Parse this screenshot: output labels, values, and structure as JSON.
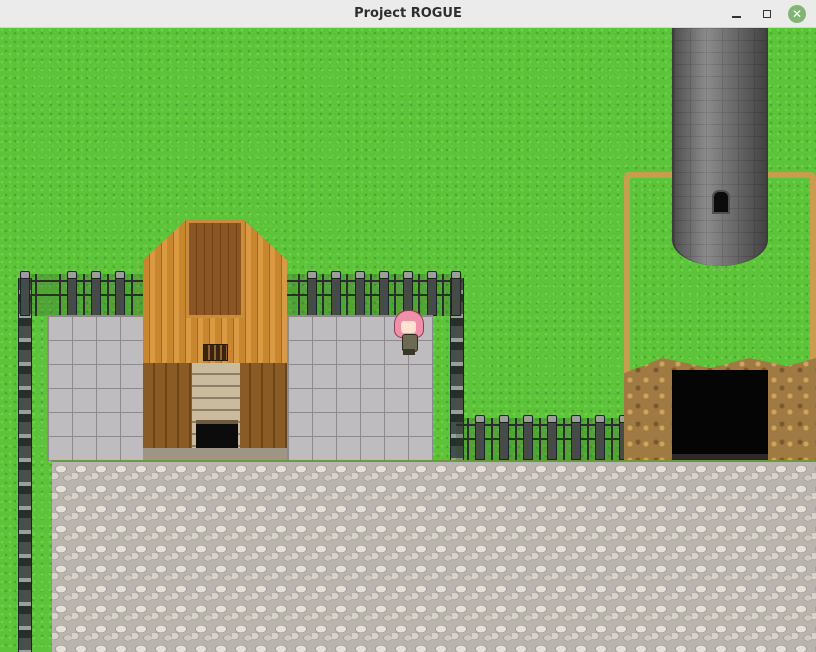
{
  "window": {
    "title": "Project ROGUE",
    "controls": {
      "minimize_icon": "minimize-icon",
      "maximize_icon": "maximize-icon",
      "close_icon": "close-icon",
      "close_glyph": "✕"
    }
  },
  "colors": {
    "titlebar": "#ebebeb",
    "close_button": "#82b573",
    "grass": "#5cc33a",
    "cobblestone": "#b9b4ad",
    "paving": "#bfbcc0",
    "roof": "#c8862f",
    "tower_stone": "#7b7b7b",
    "cliff": "#c99d4e",
    "hero_hair": "#f08fa8"
  },
  "scene": {
    "map_elements": [
      "grass-field",
      "cobblestone-road",
      "stone-paving-left",
      "stone-paving-right",
      "wooden-house",
      "stone-tower",
      "cliff-plateau",
      "cave-entrance",
      "iron-fence-top",
      "iron-fence-lower",
      "player-character"
    ]
  }
}
